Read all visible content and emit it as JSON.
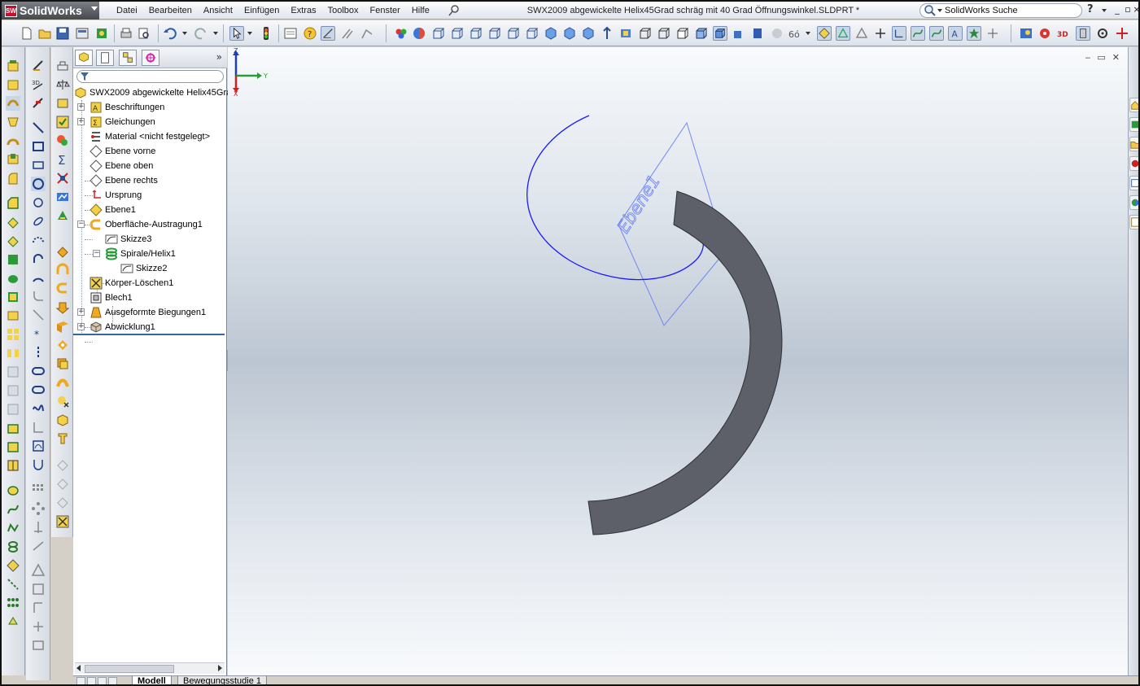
{
  "app": {
    "logo_text": "SolidWorks",
    "logo_badge": "SW"
  },
  "menu": [
    "Datei",
    "Bearbeiten",
    "Ansicht",
    "Einfügen",
    "Extras",
    "Toolbox",
    "Fenster",
    "Hilfe"
  ],
  "document_title": "SWX2009 abgewickelte Helix45Grad schräg mit 40 Grad Öffnungswinkel.SLDPRT *",
  "search": {
    "placeholder": "SolidWorks Suche"
  },
  "help_label": "?",
  "feature_tree": {
    "root": "SWX2009 abgewickelte Helix45Gra",
    "items": [
      {
        "label": "Beschriftungen",
        "icon": "annotations-icon"
      },
      {
        "label": "Gleichungen",
        "icon": "equations-icon"
      },
      {
        "label": "Material <nicht festgelegt>",
        "icon": "material-icon"
      },
      {
        "label": "Ebene vorne",
        "icon": "plane-icon"
      },
      {
        "label": "Ebene oben",
        "icon": "plane-icon"
      },
      {
        "label": "Ebene rechts",
        "icon": "plane-icon"
      },
      {
        "label": "Ursprung",
        "icon": "origin-icon"
      },
      {
        "label": "Ebene1",
        "icon": "plane-icon"
      },
      {
        "label": "Oberfläche-Austragung1",
        "icon": "surface-sweep-icon"
      },
      {
        "label": "Skizze3",
        "icon": "sketch-icon"
      },
      {
        "label": "Spirale/Helix1",
        "icon": "helix-icon"
      },
      {
        "label": "Skizze2",
        "icon": "sketch-icon"
      },
      {
        "label": "Körper-Löschen1",
        "icon": "delete-body-icon"
      },
      {
        "label": "Blech1",
        "icon": "sheet-metal-icon"
      },
      {
        "label": "Ausgeformte Biegungen1",
        "icon": "lofted-bend-icon"
      },
      {
        "label": "Abwicklung1",
        "icon": "flatten-icon"
      }
    ]
  },
  "viewport": {
    "plane_label": "Ebene1",
    "triad": {
      "z": "Z",
      "y": "Y",
      "x": "X"
    }
  },
  "bottom_tabs": [
    "Modell",
    "Bewegungsstudie 1"
  ],
  "colors": {
    "helix": "#1a1aff",
    "plane": "#6f86f5",
    "body": "#5e6069",
    "menu_bg": "#e6eaf0"
  }
}
